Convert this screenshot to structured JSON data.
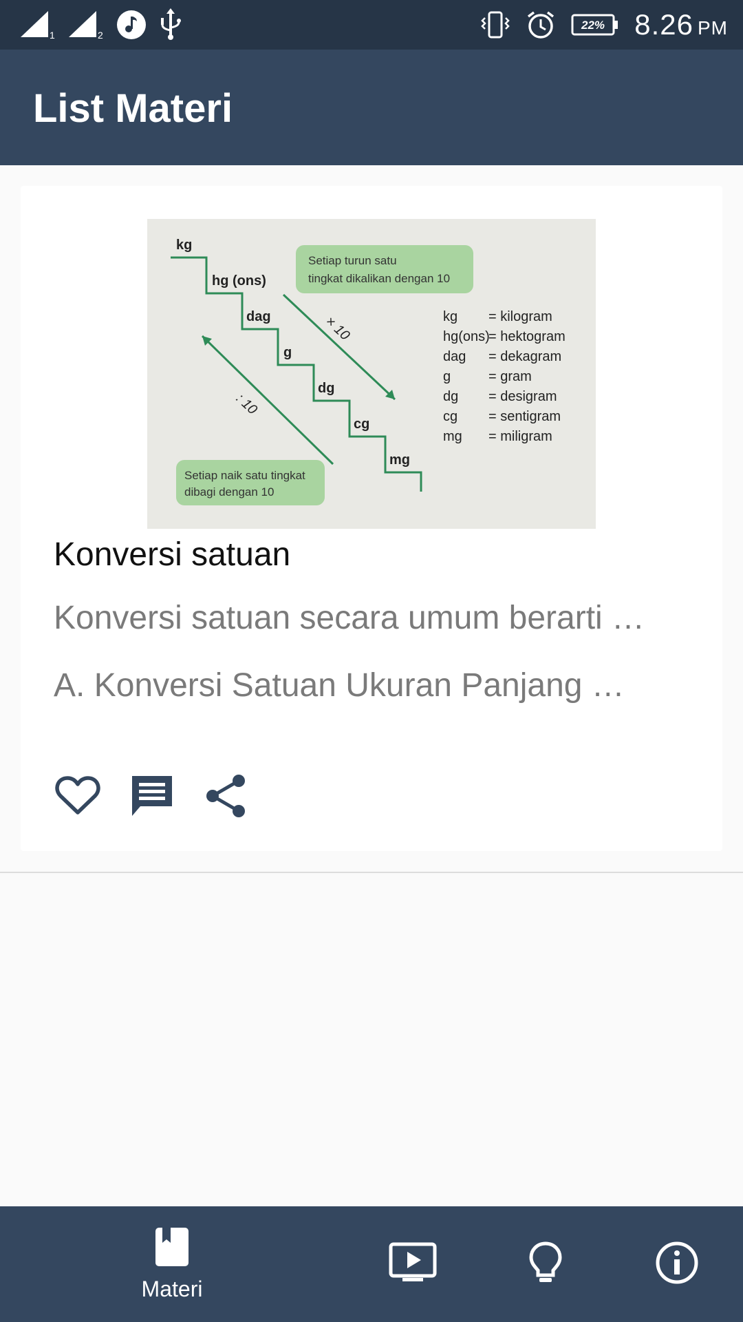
{
  "status_bar": {
    "battery": "22%",
    "time": "8.26",
    "ampm": "PM",
    "icons": [
      "signal-sim1-icon",
      "signal-sim2-icon",
      "music-icon",
      "usb-icon",
      "vibrate-icon",
      "alarm-icon",
      "battery-icon"
    ]
  },
  "app_bar": {
    "title": "List Materi"
  },
  "card": {
    "image": {
      "note_top": [
        "Setiap turun satu",
        "tingkat dikalikan dengan 10"
      ],
      "note_bottom": [
        "Setiap naik satu tingkat",
        "dibagi dengan 10"
      ],
      "steps": [
        "kg",
        "hg (ons)",
        "dag",
        "g",
        "dg",
        "cg",
        "mg"
      ],
      "arrow_down_label": "× 10",
      "arrow_up_label": ": 10",
      "legend": [
        {
          "abbr": "kg",
          "name": "= kilogram"
        },
        {
          "abbr": "hg(ons)",
          "name": "= hektogram"
        },
        {
          "abbr": "dag",
          "name": "= dekagram"
        },
        {
          "abbr": "g",
          "name": "= gram"
        },
        {
          "abbr": "dg",
          "name": "= desigram"
        },
        {
          "abbr": "cg",
          "name": "= sentigram"
        },
        {
          "abbr": "mg",
          "name": "= miligram"
        }
      ]
    },
    "title": "Konversi satuan",
    "description": "Konversi satuan secara umum berarti …",
    "subtitle": "A. Konversi Satuan Ukuran Panjang  …",
    "actions": [
      "heart-icon",
      "comment-icon",
      "share-icon"
    ]
  },
  "bottom_nav": {
    "items": [
      {
        "label": "Materi",
        "icon": "book-icon"
      },
      {
        "label": "",
        "icon": "video-icon"
      },
      {
        "label": "",
        "icon": "lightbulb-icon"
      },
      {
        "label": "",
        "icon": "info-icon"
      }
    ]
  },
  "colors": {
    "status_bar": "#263547",
    "primary": "#34475f",
    "diagram_green": "#2e8b57",
    "note_green": "#a9d4a0",
    "image_bg": "#e9e9e4"
  }
}
